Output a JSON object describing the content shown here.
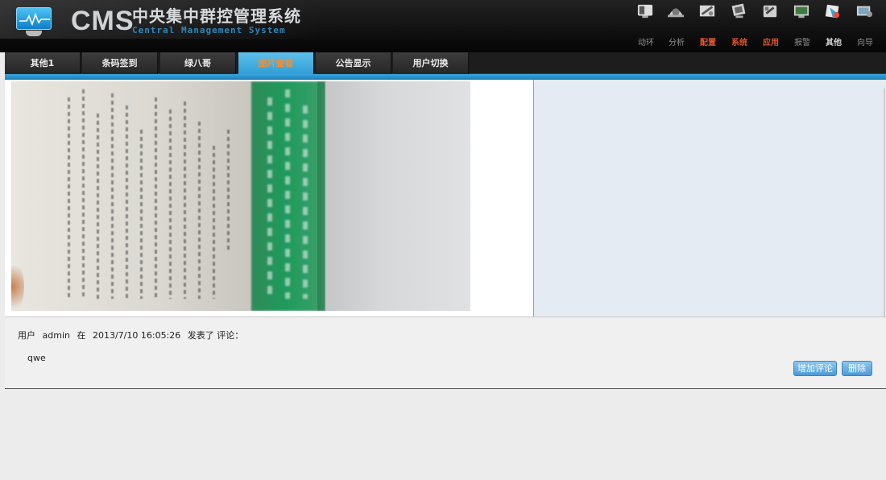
{
  "app": {
    "logo_text": "CMS",
    "title_cn": "中央集中群控管理系统",
    "title_en": "Central Management System"
  },
  "topnav": [
    {
      "label": "动环",
      "icon": "monitor-icon",
      "style": "normal"
    },
    {
      "label": "分析",
      "icon": "analysis-icon",
      "style": "normal"
    },
    {
      "label": "配置",
      "icon": "config-icon",
      "style": "highlight"
    },
    {
      "label": "系统",
      "icon": "system-icon",
      "style": "highlight"
    },
    {
      "label": "应用",
      "icon": "application-icon",
      "style": "highlight"
    },
    {
      "label": "报警",
      "icon": "alarm-icon",
      "style": "normal"
    },
    {
      "label": "其他",
      "icon": "other-icon",
      "style": "active"
    },
    {
      "label": "向导",
      "icon": "wizard-icon",
      "style": "normal"
    }
  ],
  "tabs": [
    {
      "label": "其他1",
      "active": false
    },
    {
      "label": "条码签到",
      "active": false
    },
    {
      "label": "绿八哥",
      "active": false
    },
    {
      "label": "图片查看",
      "active": true
    },
    {
      "label": "公告显示",
      "active": false
    },
    {
      "label": "用户切换",
      "active": false
    }
  ],
  "comment": {
    "prefix": "用户",
    "user": "admin",
    "at": "在",
    "datetime": "2013/7/10 16:05:26",
    "action": "发表了 评论：",
    "content": "qwe"
  },
  "buttons": {
    "add_comment": "增加评论",
    "delete": "删除"
  },
  "colors": {
    "accent_blue": "#2f9fd6",
    "highlight_orange": "#e4572e",
    "right_panel": "#e4ebf3"
  }
}
